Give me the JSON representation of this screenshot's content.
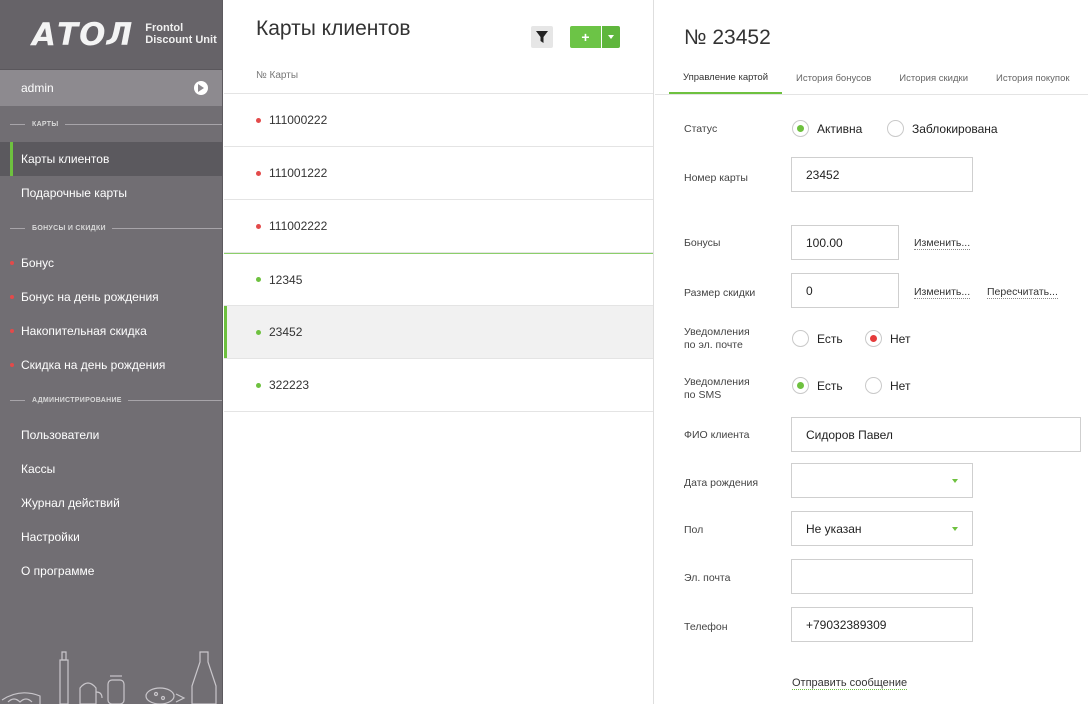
{
  "brand": {
    "logo": "АТОЛ",
    "product_line1": "Frontol",
    "product_line2": "Discount Unit"
  },
  "user": {
    "name": "admin"
  },
  "sidebar": {
    "sections": [
      {
        "title": "КАРТЫ",
        "items": [
          {
            "label": "Карты клиентов",
            "active": true
          },
          {
            "label": "Подарочные карты"
          }
        ]
      },
      {
        "title": "БОНУСЫ И СКИДКИ",
        "items": [
          {
            "label": "Бонус"
          },
          {
            "label": "Бонус на день рождения"
          },
          {
            "label": "Накопительная скидка"
          },
          {
            "label": "Скидка на день рождения"
          }
        ]
      },
      {
        "title": "АДМИНИСТРИРОВАНИЕ",
        "items": [
          {
            "label": "Пользователи"
          },
          {
            "label": "Кассы"
          },
          {
            "label": "Журнал действий"
          },
          {
            "label": "Настройки"
          },
          {
            "label": "О программе"
          }
        ]
      }
    ]
  },
  "list": {
    "title": "Карты клиентов",
    "add_label": "+",
    "column": "№ Карты",
    "rows": [
      {
        "number": "111000222",
        "status_color": "#e34a4a"
      },
      {
        "number": "111001222",
        "status_color": "#e34a4a"
      },
      {
        "number": "111002222",
        "status_color": "#e34a4a"
      },
      {
        "number": "12345",
        "status_color": "#6ec13f"
      },
      {
        "number": "23452",
        "status_color": "#6ec13f",
        "selected": true
      },
      {
        "number": "322223",
        "status_color": "#6ec13f"
      }
    ]
  },
  "detail": {
    "title": "№ 23452",
    "tabs": [
      "Управление картой",
      "История бонусов",
      "История скидки",
      "История покупок"
    ],
    "status": {
      "label": "Статус",
      "opt_active": "Активна",
      "opt_blocked": "Заблокирована"
    },
    "card_number": {
      "label": "Номер карты",
      "value": "23452"
    },
    "bonuses": {
      "label": "Бонусы",
      "value": "100.00",
      "change": "Изменить..."
    },
    "discount": {
      "label": "Размер скидки",
      "value": "0",
      "change": "Изменить...",
      "recalc": "Пересчитать..."
    },
    "email_notify": {
      "label1": "Уведомления",
      "label2": "по эл. почте",
      "yes": "Есть",
      "no": "Нет"
    },
    "sms_notify": {
      "label1": "Уведомления",
      "label2": "по SMS",
      "yes": "Есть",
      "no": "Нет"
    },
    "fio": {
      "label": "ФИО клиента",
      "value": "Сидоров Павел"
    },
    "birthdate": {
      "label": "Дата рождения",
      "value": ""
    },
    "gender": {
      "label": "Пол",
      "value": "Не указан"
    },
    "email": {
      "label": "Эл. почта",
      "value": ""
    },
    "phone": {
      "label": "Телефон",
      "value": "+79032389309"
    },
    "send_message": "Отправить сообщение"
  },
  "colors": {
    "accent": "#6ec13f",
    "danger": "#e34a4a",
    "sidebar": "#716e73"
  }
}
